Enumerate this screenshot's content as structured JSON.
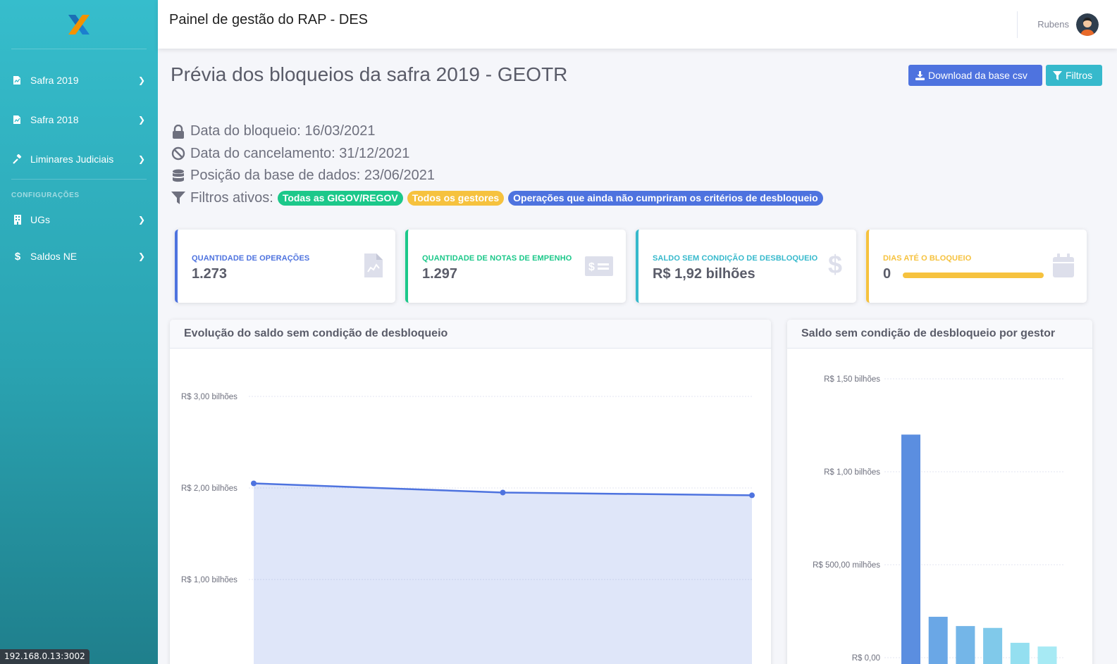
{
  "app": {
    "title": "Painel de gestão do RAP - DES",
    "user_name": "Rubens",
    "host_tag": "192.168.0.13:3002"
  },
  "sidebar": {
    "items": [
      {
        "label": "Safra 2019",
        "icon": "file-chart-icon"
      },
      {
        "label": "Safra 2018",
        "icon": "file-chart-icon"
      },
      {
        "label": "Liminares Judiciais",
        "icon": "gavel-icon"
      }
    ],
    "config_heading": "CONFIGURAÇÕES",
    "config_items": [
      {
        "label": "UGs",
        "icon": "building-icon"
      },
      {
        "label": "Saldos NE",
        "icon": "dollar-icon"
      }
    ]
  },
  "page": {
    "title": "Prévia dos bloqueios da safra 2019 - GEOTR",
    "download_label": "Download da base csv",
    "filter_label": "Filtros"
  },
  "info": {
    "bloqueio": "Data do bloqueio: 16/03/2021",
    "cancelamento": "Data do cancelamento: 31/12/2021",
    "posicao": "Posição da base de dados: 23/06/2021",
    "filtros_label": "Filtros ativos:",
    "badges": [
      "Todas as GIGOV/REGOV",
      "Todos os gestores",
      "Operações que ainda não cumpriram os critérios de desbloqueio"
    ]
  },
  "cards": [
    {
      "label": "QUANTIDADE DE OPERAÇÕES",
      "value": "1.273",
      "color": "#4e73df",
      "icon": "file-invoice-icon"
    },
    {
      "label": "QUANTIDADE DE NOTAS DE EMPENHO",
      "value": "1.297",
      "color": "#1cc88a",
      "icon": "money-check-icon"
    },
    {
      "label": "SALDO SEM CONDIÇÃO DE DESBLOQUEIO",
      "value": "R$ 1,92 bilhões",
      "color": "#36b9cc",
      "icon": "dollar-icon"
    },
    {
      "label": "DIAS ATÉ O BLOQUEIO",
      "value": "0",
      "color": "#f6c23e",
      "icon": "calendar-icon",
      "progress_percent": 100
    }
  ],
  "colors": {
    "primary": "#4e73df",
    "success": "#1cc88a",
    "info": "#36b9cc",
    "warning": "#f6c23e"
  },
  "chart_data": [
    {
      "type": "area",
      "title": "Evolução do saldo sem condição de desbloqueio",
      "ylabel_ticks": [
        "R$ 3,00 bilhões",
        "R$ 2,00 bilhões",
        "R$ 1,00 bilhões"
      ],
      "y_tick_values": [
        3.0,
        2.0,
        1.0
      ],
      "ylim": [
        0,
        3.0
      ],
      "unit": "bilhões",
      "series": [
        {
          "values": [
            2.05,
            1.95,
            1.92
          ]
        }
      ],
      "grid": true,
      "color": "#4e73df"
    },
    {
      "type": "bar",
      "title": "Saldo sem condição de desbloqueio por gestor",
      "ylabel_ticks": [
        "R$ 1,50 bilhões",
        "R$ 1,00 bilhões",
        "R$ 500,00 milhões",
        "R$ 0,00"
      ],
      "y_tick_values": [
        1.5,
        1.0,
        0.5,
        0.0
      ],
      "ylim": [
        0,
        1.5
      ],
      "unit": "bilhões",
      "values": [
        1.2,
        0.22,
        0.17,
        0.16,
        0.08,
        0.06
      ],
      "bar_colors": [
        "#5b8ee0",
        "#6aa7e6",
        "#74b6e8",
        "#80c9ea",
        "#94dff0",
        "#a7eaf4"
      ],
      "grid": true
    }
  ]
}
